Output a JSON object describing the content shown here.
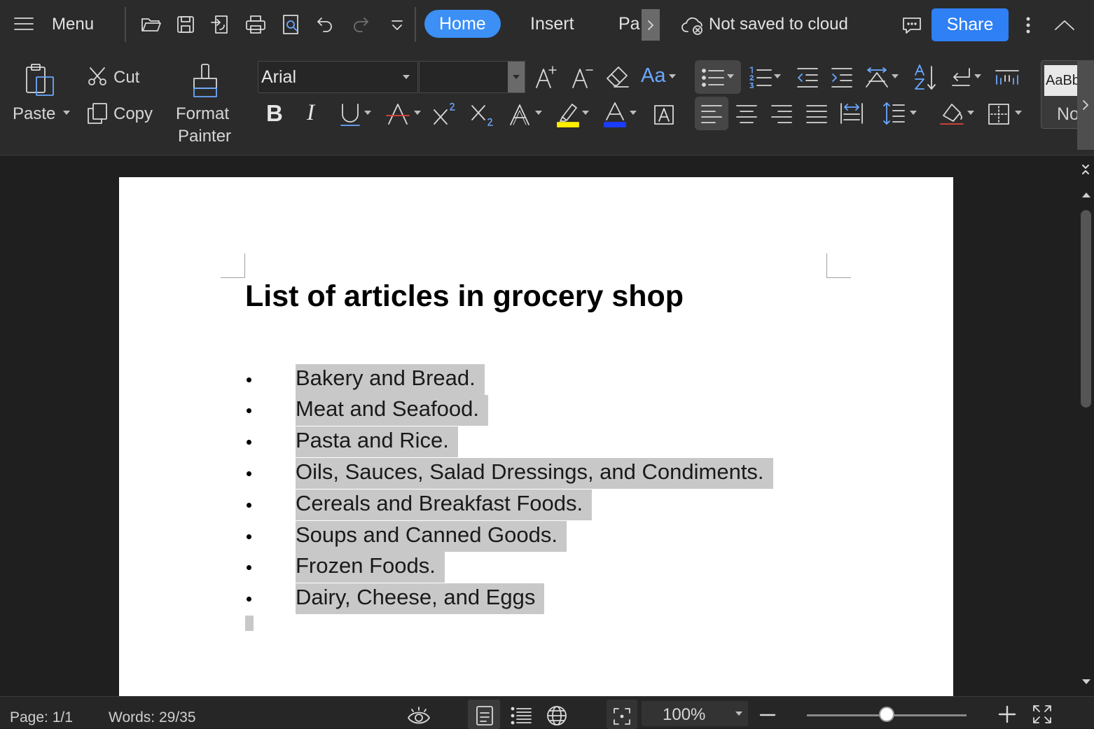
{
  "topbar": {
    "menu_label": "Menu",
    "tabs": [
      {
        "label": "Home",
        "active": true
      },
      {
        "label": "Insert",
        "active": false
      },
      {
        "label": "Pa",
        "active": false
      }
    ],
    "cloud_status": "Not saved to cloud",
    "share_label": "Share",
    "quick_access_icons": [
      "open-folder-icon",
      "save-icon",
      "export-icon",
      "print-icon",
      "print-preview-icon",
      "undo-icon",
      "redo-icon",
      "customize-dropdown-icon"
    ]
  },
  "ribbon": {
    "paste_label": "Paste",
    "cut_label": "Cut",
    "copy_label": "Copy",
    "format_painter_line1": "Format",
    "format_painter_line2": "Painter",
    "font_name": "Arial",
    "font_size": "",
    "case_label": "Aa",
    "styles_sample": "AaBb",
    "styles_name": "No"
  },
  "document": {
    "title": "List of articles in grocery shop",
    "items": [
      "Bakery and Bread.",
      "Meat and Seafood.",
      "Pasta and Rice.",
      "Oils, Sauces, Salad Dressings, and Condiments.",
      "Cereals and Breakfast Foods.",
      "Soups and Canned Goods.",
      "Frozen Foods.",
      "Dairy, Cheese, and Eggs"
    ]
  },
  "status": {
    "page": "Page: 1/1",
    "words": "Words: 29/35",
    "zoom": "100%",
    "zoom_fraction": 0.5
  },
  "colors": {
    "accent": "#2f7ff5",
    "background": "#2b2b2b",
    "selection": "#c8c8c8",
    "highlight_yellow": "#ffee00",
    "font_color_blue": "#1a3cff",
    "strike_red": "#e0443a"
  }
}
